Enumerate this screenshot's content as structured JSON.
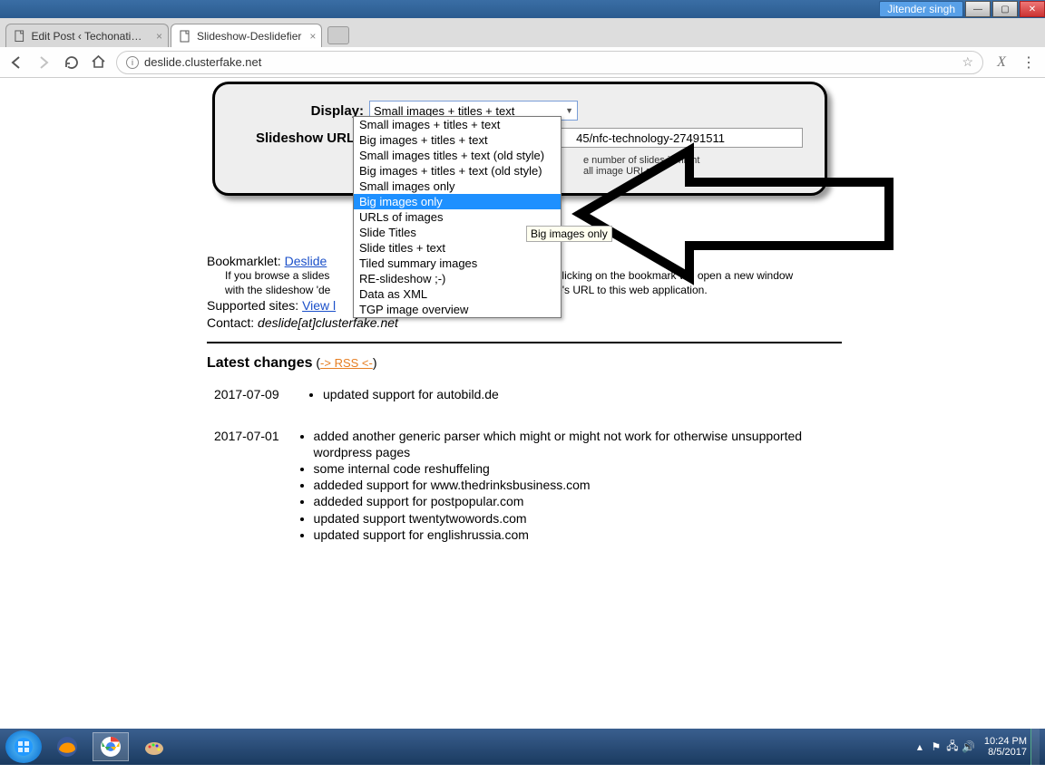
{
  "window": {
    "user": "Jitender singh"
  },
  "tabs": {
    "inactive": "Edit Post ‹ Techonation –",
    "active": "Slideshow-Deslidefier"
  },
  "url": "deslide.clusterfake.net",
  "form": {
    "display_label": "Display:",
    "display_selected": "Small images + titles + text",
    "url_label": "Slideshow URL:",
    "url_value": "45/nfc-technology-27491511",
    "hint1": "e number of slides it might",
    "hint2": "all image URLs"
  },
  "dropdown": {
    "options": [
      "Small images + titles + text",
      "Big images + titles + text",
      "Small images titles + text (old style)",
      "Big images + titles + text (old style)",
      "Small images only",
      "Big images only",
      "URLs of images",
      "Slide Titles",
      "Slide titles + text",
      "Tiled summary images",
      "RE-slideshow ;-)",
      "Data as XML",
      "TGP image overview"
    ],
    "highlighted": "Big images only",
    "tooltip": "Big images only"
  },
  "content": {
    "bookmarklet_label": "Bookmarklet: ",
    "bookmarklet_link": "Deslide",
    "bookmarklet_line1a": "If you browse a slides",
    "bookmarklet_line1b": "d, clicking on the bookmark will open a new window",
    "bookmarklet_line2a": "with the slideshow 'de",
    "bookmarklet_line2b": "site's URL to this web application.",
    "supported_label": "Supported sites: ",
    "supported_link": "View l",
    "contact_label": "Contact: ",
    "contact_value": "deslide[at]clusterfake.net",
    "changes_title": "Latest changes",
    "rss": "-> RSS <-",
    "changes": [
      {
        "date": "2017-07-09",
        "items": [
          "updated support for autobild.de"
        ]
      },
      {
        "date": "2017-07-01",
        "items": [
          "added another generic parser which might or might not work for otherwise unsupported wordpress pages",
          "some internal code reshuffeling",
          "addeded support for www.thedrinksbusiness.com",
          "addeded support for postpopular.com",
          "updated support twentytwowords.com",
          "updated support for englishrussia.com"
        ]
      }
    ]
  },
  "taskbar": {
    "time": "10:24 PM",
    "date": "8/5/2017"
  }
}
